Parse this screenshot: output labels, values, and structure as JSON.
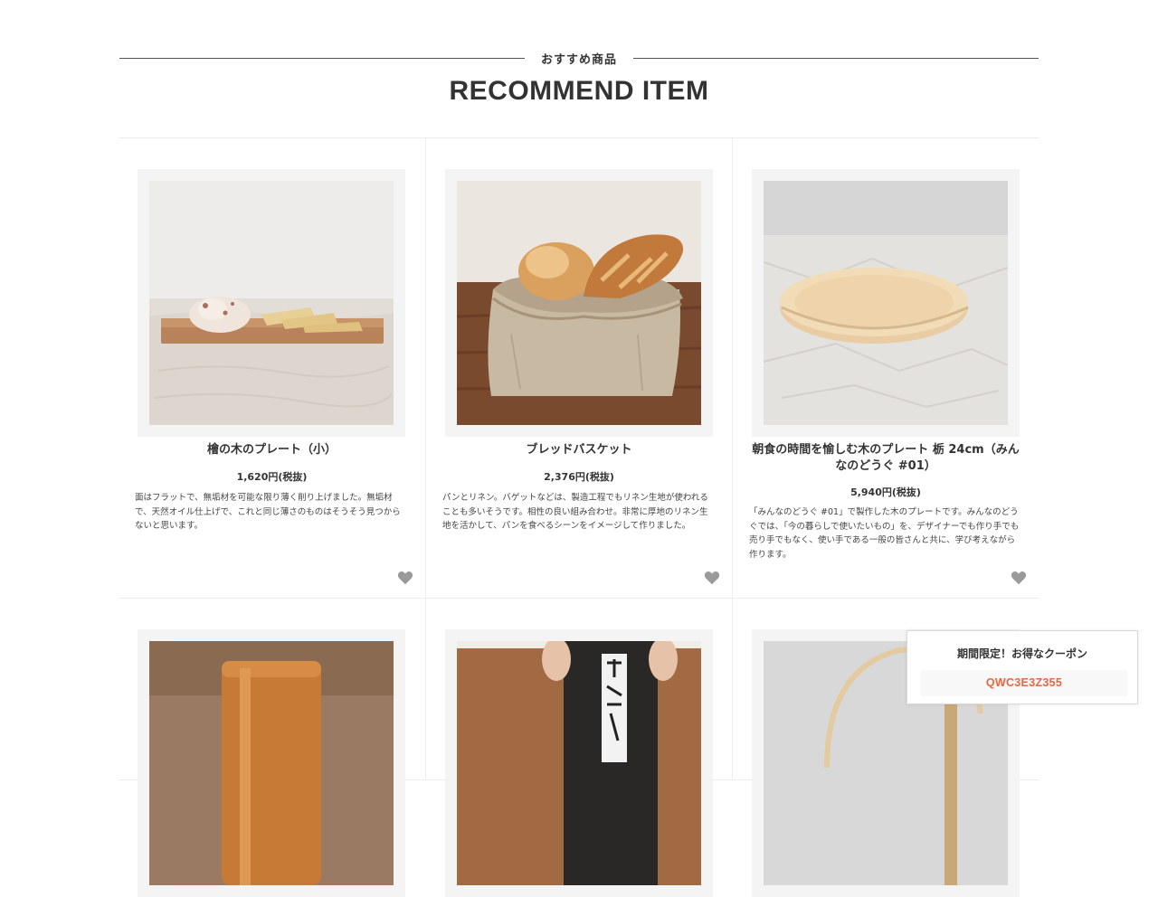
{
  "section": {
    "title_jp": "おすすめ商品",
    "title_en": "RECOMMEND ITEM"
  },
  "products": [
    {
      "name": "檜の木のプレート（小）",
      "price": "1,620円(税抜)",
      "description": "面はフラットで、無垢材を可能な限り薄く削り上げました。無垢材で、天然オイル仕上げで、これと同じ薄さのものはそうそう見つからないと思います。",
      "image": "wooden-plate-with-crackers-photo"
    },
    {
      "name": "ブレッドバスケット",
      "price": "2,376円(税抜)",
      "description": "パンとリネン。バゲットなどは、製造工程でもリネン生地が使われることも多いそうです。相性の良い組み合わせ。非常に厚地のリネン生地を活かして、パンを食べるシーンをイメージして作りました。",
      "image": "linen-bread-basket-photo"
    },
    {
      "name": "朝食の時間を愉しむ木のプレート 栃 24cm（みんなのどうぐ #01）",
      "price": "5,940円(税抜)",
      "description": "「みんなのどうぐ #01」で製作した木のプレートです。みんなのどうぐでは、「今の暮らしで使いたいもの」を、デザイナーでも作り手でも売り手でもなく、使い手である一般の皆さんと共に、学び考えながら作ります。",
      "image": "round-wooden-plate-photo"
    },
    {
      "image": "wooden-canister-photo"
    },
    {
      "image": "tea-package-photo"
    },
    {
      "image": "rattan-handle-photo"
    }
  ],
  "favorite_icon": "heart-icon",
  "coupon": {
    "title": "期間限定！お得なクーポン",
    "code": "QWC3E3Z355"
  },
  "colors": {
    "text": "#333333",
    "coupon_code": "#e8663d",
    "heart": "#9a9a9a",
    "divider": "#ececec"
  }
}
